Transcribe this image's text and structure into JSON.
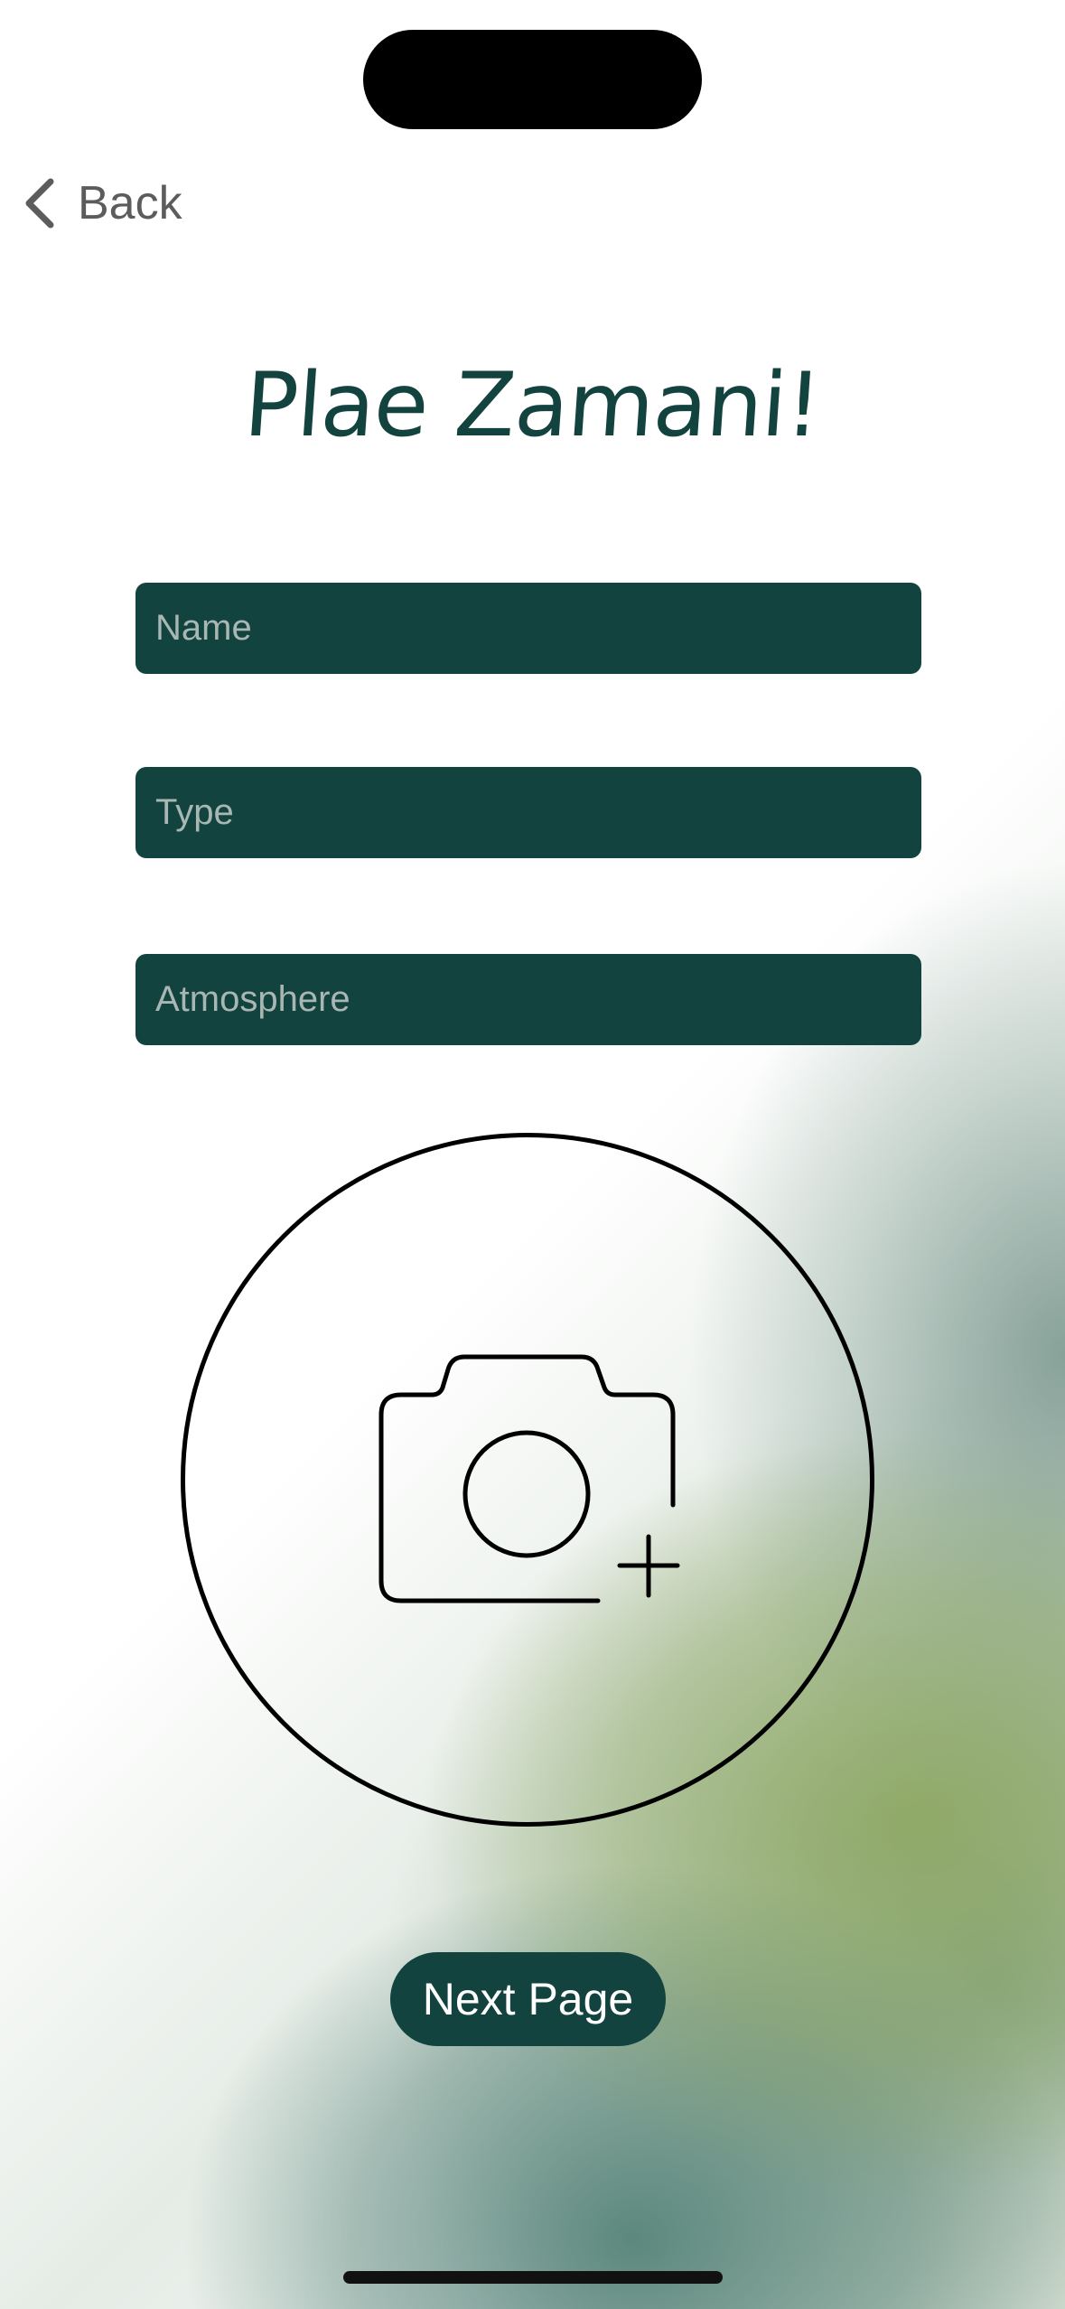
{
  "nav": {
    "back_label": "Back",
    "back_icon": "chevron-left-icon"
  },
  "page": {
    "title": "Plae Zamani!"
  },
  "form": {
    "name_placeholder": "Name",
    "type_placeholder": "Type",
    "atmosphere_placeholder": "Atmosphere",
    "name_value": "",
    "type_value": "",
    "atmosphere_value": ""
  },
  "photo": {
    "icon": "camera-plus-icon"
  },
  "footer": {
    "next_label": "Next Page"
  },
  "colors": {
    "accent": "#12433e",
    "placeholder": "#a8b7b3",
    "back_text": "#5c5c5c"
  }
}
